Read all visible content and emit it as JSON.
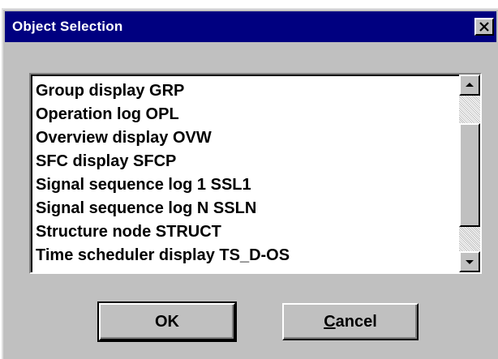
{
  "window": {
    "title": "Object Selection",
    "close_symbol": "✕"
  },
  "list": {
    "items": [
      "Group display GRP",
      "Operation log OPL",
      "Overview display OVW",
      "SFC display SFCP",
      "Signal sequence log 1 SSL1",
      "Signal sequence log N SSLN",
      "Structure node STRUCT",
      "Time scheduler display TS_D-OS"
    ]
  },
  "buttons": {
    "ok_label": "OK",
    "cancel_first": "C",
    "cancel_rest": "ancel"
  },
  "colors": {
    "titlebar": "#000080",
    "face": "#c0c0c0",
    "list_bg": "#ffffff"
  },
  "icons": {
    "close": "close-icon",
    "scroll_up": "scroll-up-arrow-icon",
    "scroll_down": "scroll-down-arrow-icon"
  }
}
